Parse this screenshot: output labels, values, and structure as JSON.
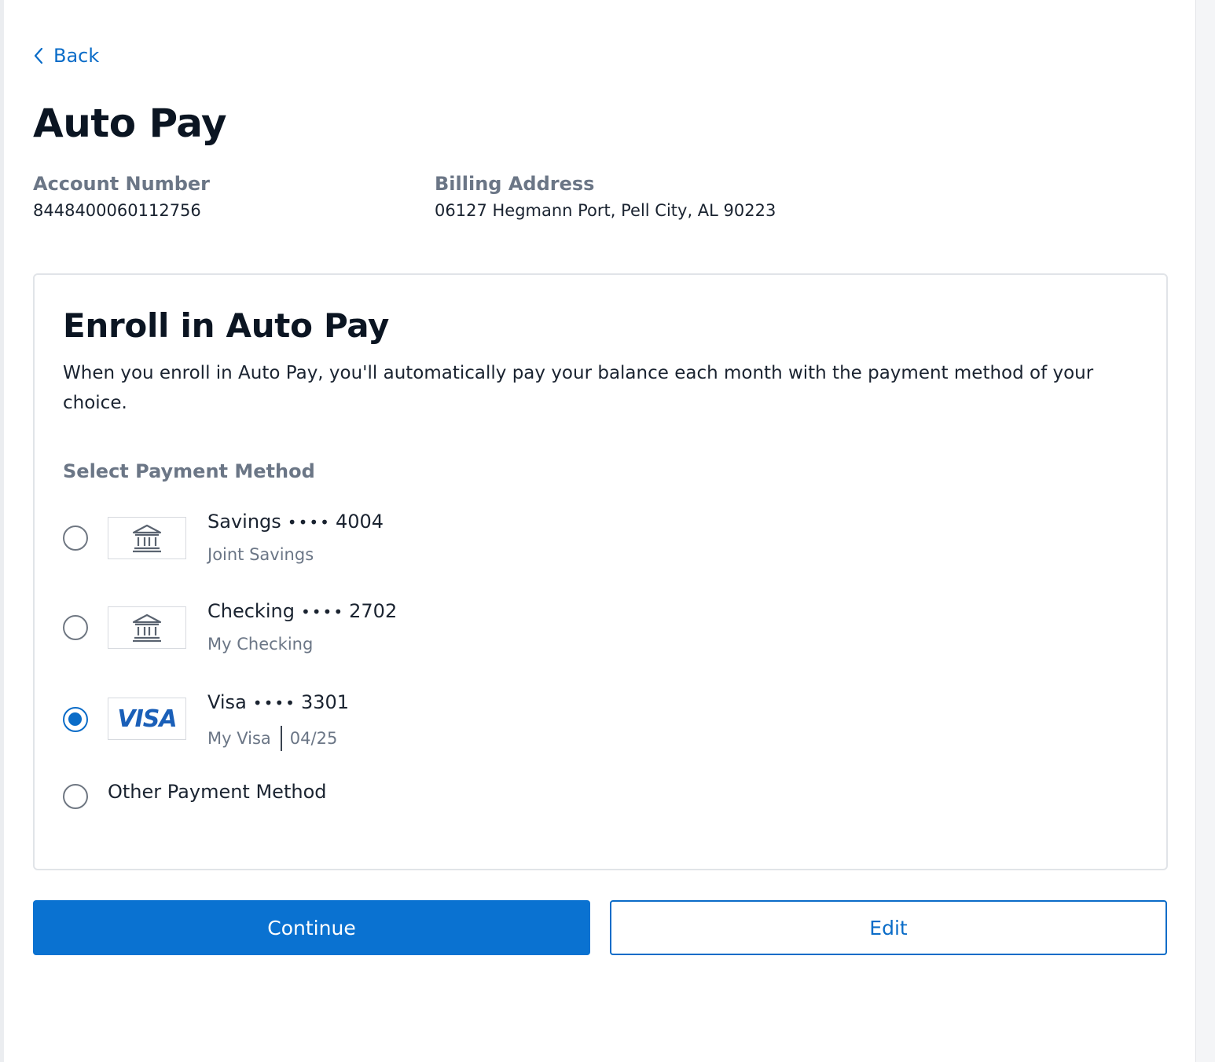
{
  "nav": {
    "back_label": "Back"
  },
  "page": {
    "title": "Auto Pay"
  },
  "account": {
    "number_label": "Account Number",
    "number_value": "8448400060112756",
    "address_label": "Billing Address",
    "address_value": "06127 Hegmann Port, Pell City, AL 90223"
  },
  "enroll": {
    "title": "Enroll in Auto Pay",
    "description": "When you enroll in Auto Pay, you'll automatically pay your balance each month with the payment method of your choice.",
    "select_label": "Select Payment Method",
    "methods": [
      {
        "type": "Savings",
        "dots": "••••",
        "last4": "4004",
        "nickname": "Joint Savings",
        "icon": "bank-icon",
        "selected": false
      },
      {
        "type": "Checking",
        "dots": "••••",
        "last4": "2702",
        "nickname": "My Checking",
        "icon": "bank-icon",
        "selected": false
      },
      {
        "type": "Visa",
        "dots": "••••",
        "last4": "3301",
        "nickname": "My Visa",
        "expiry": "04/25",
        "logo_text": "VISA",
        "icon": "visa-logo",
        "selected": true
      }
    ],
    "other_label": "Other Payment Method"
  },
  "actions": {
    "continue_label": "Continue",
    "edit_label": "Edit"
  },
  "colors": {
    "accent": "#0a72d1",
    "link": "#0a6cc8",
    "muted": "#6b7686",
    "heading": "#0b1522"
  }
}
